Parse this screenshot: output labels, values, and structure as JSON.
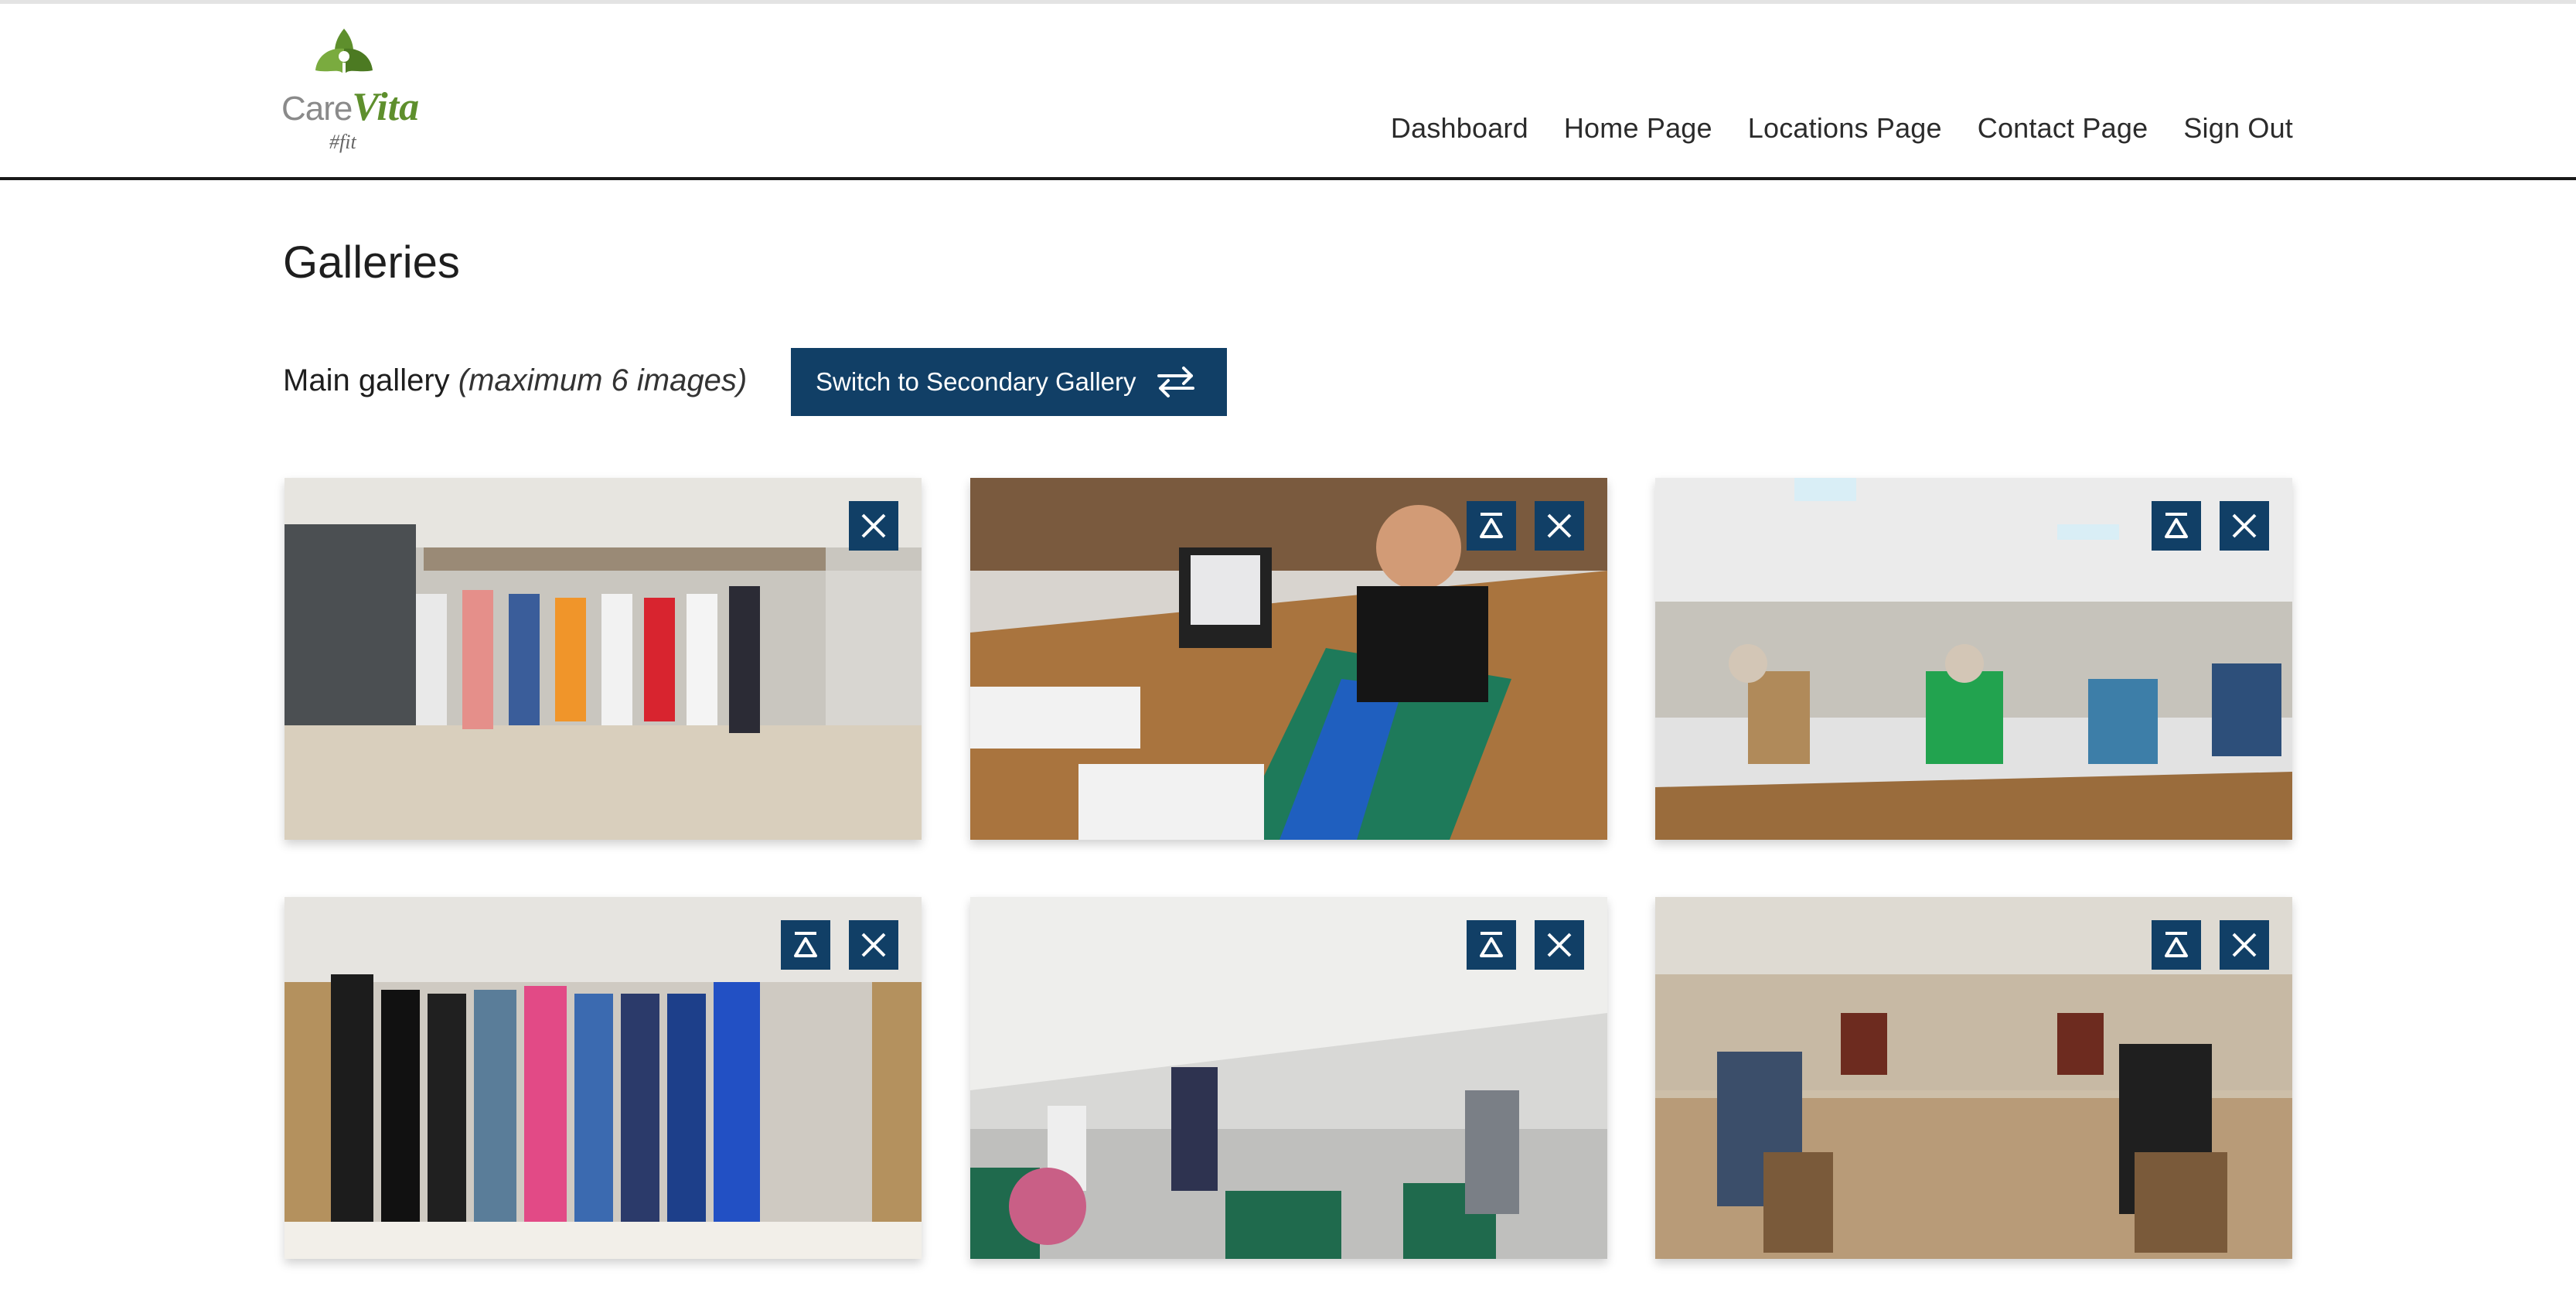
{
  "app": {
    "logo_text_care": "Care",
    "logo_text_vita": "Vita",
    "logo_tagline": "#fit"
  },
  "nav": {
    "items": [
      {
        "label": "Dashboard"
      },
      {
        "label": "Home Page"
      },
      {
        "label": "Locations Page"
      },
      {
        "label": "Contact Page"
      },
      {
        "label": "Sign Out"
      }
    ]
  },
  "page": {
    "title": "Galleries"
  },
  "gallery": {
    "label": "Main gallery",
    "note": "(maximum 6 images)",
    "switch_button_label": "Switch to Secondary Gallery",
    "switch_icon": "swap-arrows-icon",
    "images": [
      {
        "alt": "Group photo outside building",
        "has_move_top": false
      },
      {
        "alt": "Instructor at table with laptop",
        "has_move_top": true
      },
      {
        "alt": "Seated exercise class in dining hall",
        "has_move_top": true
      },
      {
        "alt": "Group photo indoors with flowers",
        "has_move_top": true
      },
      {
        "alt": "Seated exercise class with arms raised",
        "has_move_top": true
      },
      {
        "alt": "Chair exercise class in large hall",
        "has_move_top": true
      }
    ]
  },
  "colors": {
    "brand_navy": "#113f66",
    "logo_green": "#5e8f2c",
    "text_dark": "#1e1e1e"
  }
}
